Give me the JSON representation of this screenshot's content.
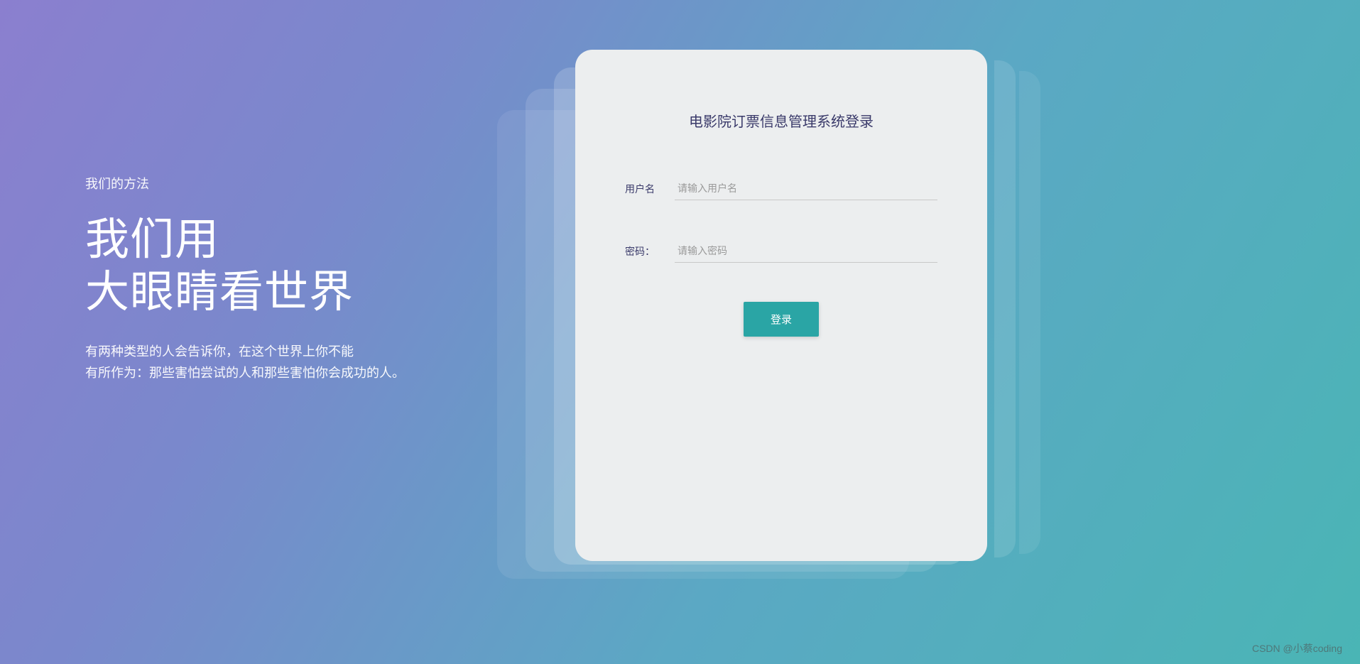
{
  "hero": {
    "caption": "我们的方法",
    "headline_line1": "我们用",
    "headline_line2": "大眼睛看世界",
    "subtext_line1": "有两种类型的人会告诉你，在这个世界上你不能",
    "subtext_line2": "有所作为：那些害怕尝试的人和那些害怕你会成功的人。"
  },
  "login": {
    "title": "电影院订票信息管理系统登录",
    "username_label": "用户名",
    "username_placeholder": "请输入用户名",
    "username_value": "",
    "password_label": "密码：",
    "password_placeholder": "请输入密码",
    "password_value": "",
    "submit_label": "登录"
  },
  "watermark": "CSDN @小蔡coding"
}
